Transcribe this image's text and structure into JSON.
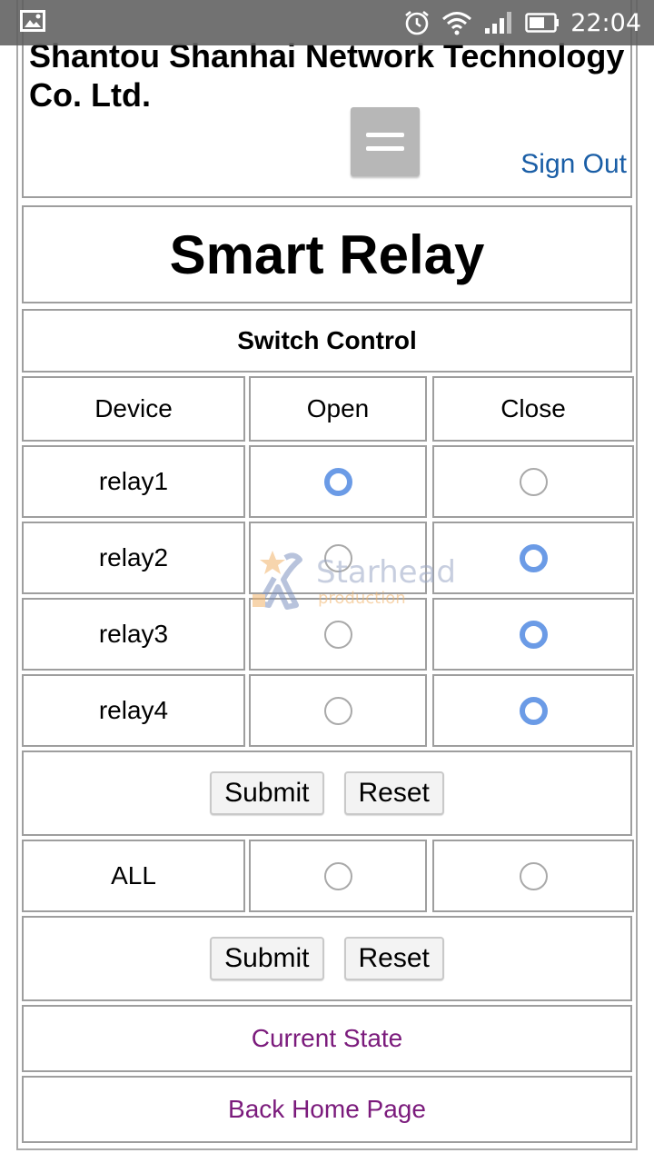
{
  "status_bar": {
    "time": "22:04"
  },
  "header": {
    "company": "Shantou Shanhai Network Technology Co. Ltd.",
    "sign_out": "Sign Out"
  },
  "title": "Smart Relay",
  "subtitle": "Switch Control",
  "table": {
    "headers": [
      "Device",
      "Open",
      "Close"
    ],
    "rows": [
      {
        "device": "relay1",
        "state": "open"
      },
      {
        "device": "relay2",
        "state": "close"
      },
      {
        "device": "relay3",
        "state": "close"
      },
      {
        "device": "relay4",
        "state": "close"
      }
    ]
  },
  "buttons": {
    "submit": "Submit",
    "reset": "Reset"
  },
  "all_row": {
    "label": "ALL",
    "state": "none"
  },
  "links": {
    "current_state": "Current State",
    "back_home": "Back Home Page"
  },
  "watermark": {
    "line1": "Starhead",
    "line2": "production"
  },
  "colors": {
    "radio_checked": "#6b9be6",
    "link_visited": "#7b1b7c",
    "sign_out": "#1a5ea6"
  }
}
